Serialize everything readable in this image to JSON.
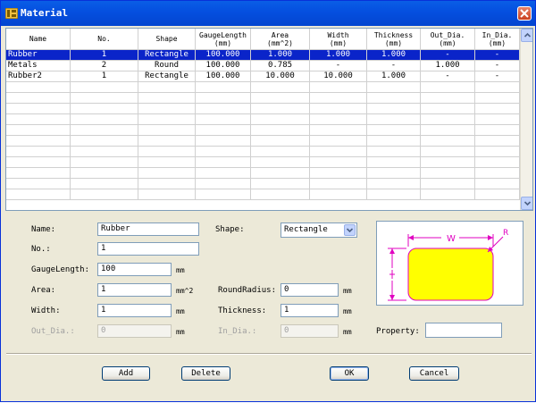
{
  "window": {
    "title": "Material"
  },
  "grid": {
    "columns": [
      {
        "label": "Name",
        "unit": ""
      },
      {
        "label": "No.",
        "unit": ""
      },
      {
        "label": "Shape",
        "unit": ""
      },
      {
        "label": "GaugeLength",
        "unit": "(mm)"
      },
      {
        "label": "Area",
        "unit": "(mm^2)"
      },
      {
        "label": "Width",
        "unit": "(mm)"
      },
      {
        "label": "Thickness",
        "unit": "(mm)"
      },
      {
        "label": "Out_Dia.",
        "unit": "(mm)"
      },
      {
        "label": "In_Dia.",
        "unit": "(mm)"
      }
    ],
    "rows": [
      [
        "Rubber",
        "1",
        "Rectangle",
        "100.000",
        "1.000",
        "1.000",
        "1.000",
        "-",
        "-"
      ],
      [
        "Metals",
        "2",
        "Round",
        "100.000",
        "0.785",
        "-",
        "-",
        "1.000",
        "-"
      ],
      [
        "Rubber2",
        "1",
        "Rectangle",
        "100.000",
        "10.000",
        "10.000",
        "1.000",
        "-",
        "-"
      ]
    ],
    "selected_row": 0
  },
  "form": {
    "name_label": "Name:",
    "name_value": "Rubber",
    "no_label": "No.:",
    "no_value": "1",
    "gauge_label": "GaugeLength:",
    "gauge_value": "100",
    "gauge_unit": "mm",
    "area_label": "Area:",
    "area_value": "1",
    "area_unit": "mm^2",
    "width_label": "Width:",
    "width_value": "1",
    "width_unit": "mm",
    "outdia_label": "Out_Dia.:",
    "outdia_value": "0",
    "outdia_unit": "mm",
    "shape_label": "Shape:",
    "shape_value": "Rectangle",
    "roundradius_label": "RoundRadius:",
    "roundradius_value": "0",
    "roundradius_unit": "mm",
    "thickness_label": "Thickness:",
    "thickness_value": "1",
    "thickness_unit": "mm",
    "india_label": "In_Dia.:",
    "india_value": "0",
    "india_unit": "mm",
    "property_label": "Property:",
    "property_value": "",
    "preview": {
      "width_mark": "W",
      "radius_mark": "R"
    }
  },
  "buttons": {
    "add": "Add",
    "delete": "Delete",
    "ok": "OK",
    "cancel": "Cancel"
  },
  "colors": {
    "title_bar": "#0550e0",
    "selection": "#0a24c9",
    "shape_fill": "#ffff00",
    "dimension": "#e000c0"
  }
}
